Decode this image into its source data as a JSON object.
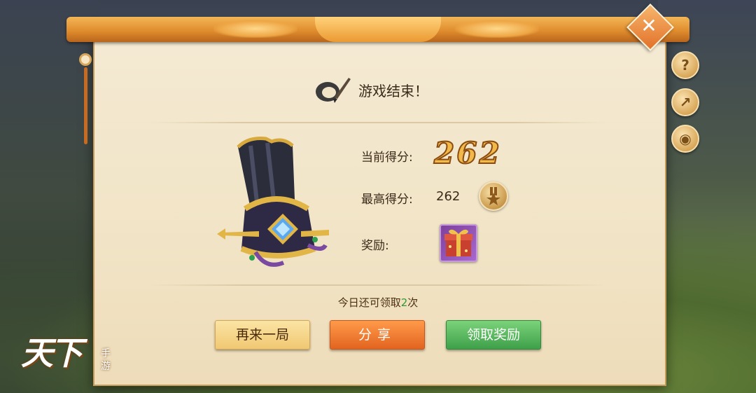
{
  "dialog": {
    "title": "游戏结束！",
    "close_label": "✕"
  },
  "side_buttons": {
    "help_label": "?",
    "share_label": "↗",
    "view_label": "◉"
  },
  "scores": {
    "current_label": "当前得分:",
    "current_value": "262",
    "best_label": "最高得分:",
    "best_value": "262",
    "reward_label": "奖励:"
  },
  "remaining": {
    "prefix": "今日还可领取",
    "count": "2",
    "suffix": "次"
  },
  "buttons": {
    "replay": "再来一局",
    "share": "分享",
    "claim": "领取奖励"
  },
  "logo": {
    "main": "天下",
    "sub": "手游"
  },
  "colors": {
    "panel": "#f2e6c9",
    "accent_orange": "#e07a2a",
    "claim_green": "#3ea04a",
    "count_green": "#2f9a2f"
  }
}
